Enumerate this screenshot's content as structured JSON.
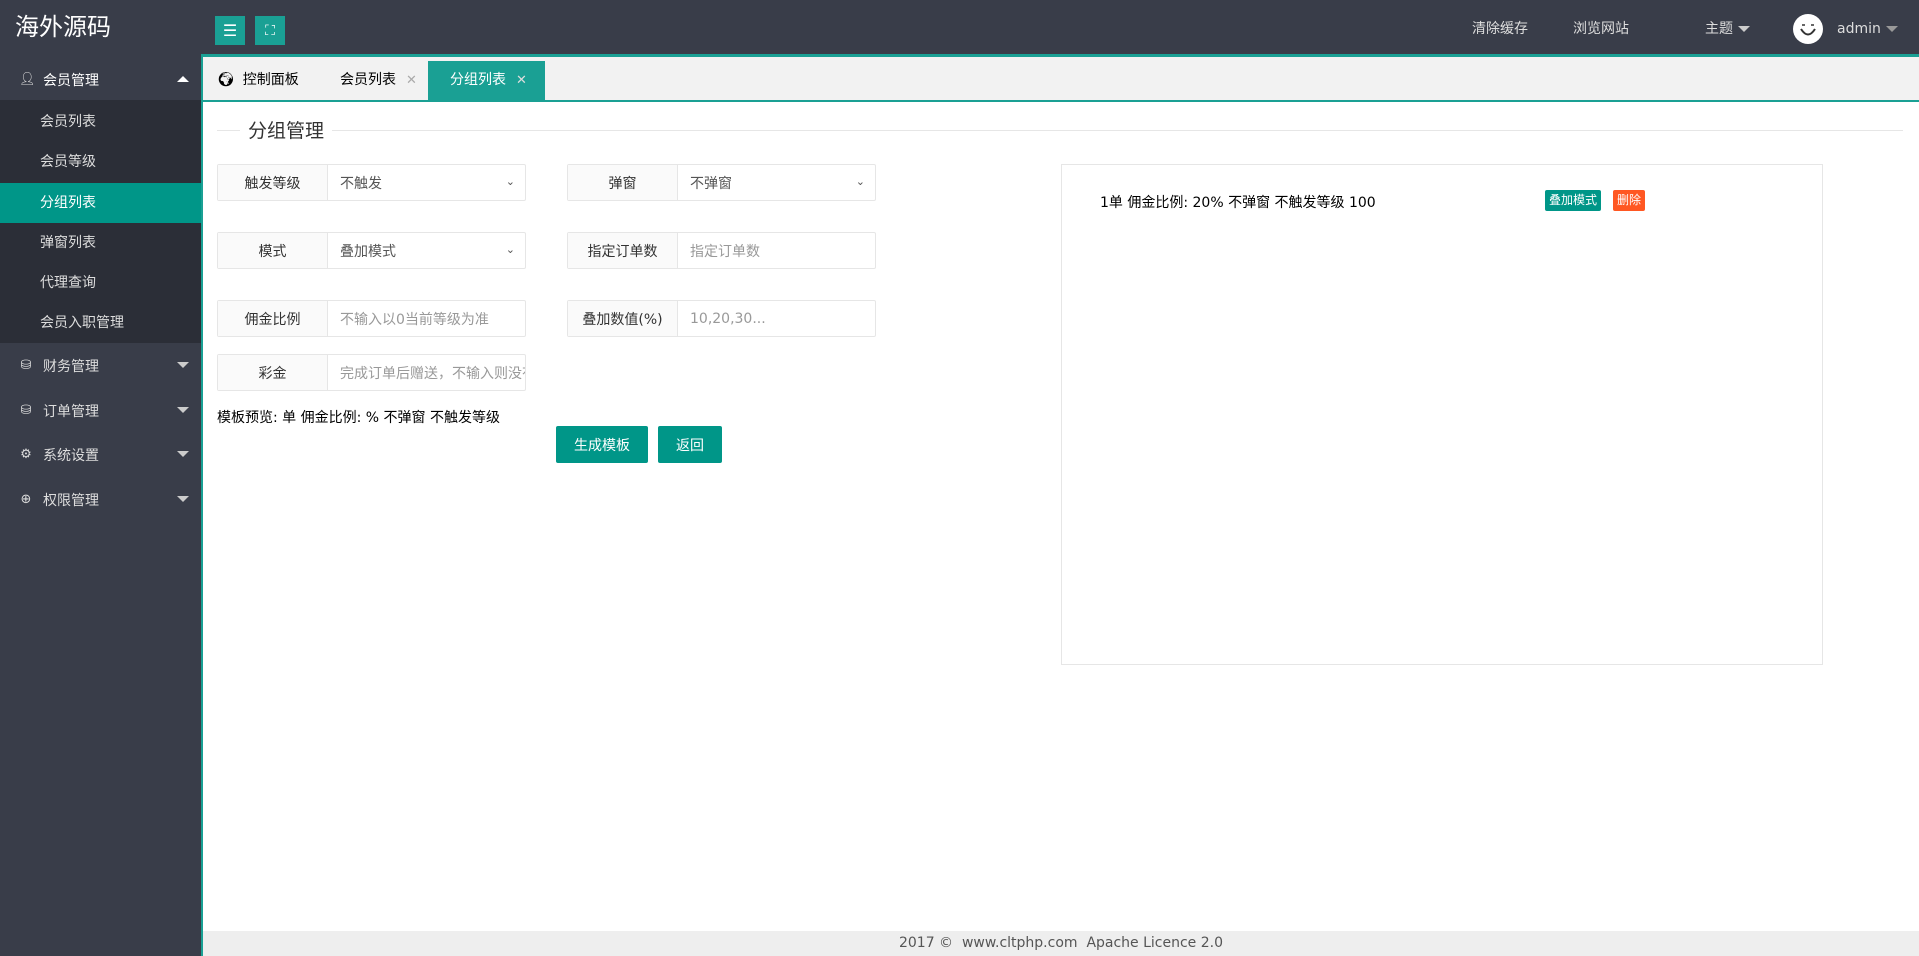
{
  "header": {
    "logo": "海外源码",
    "links": {
      "clear_cache": "清除缓存",
      "browse_site": "浏览网站",
      "theme": "主题",
      "user": "admin"
    }
  },
  "sidebar": {
    "groups": [
      {
        "label": "会员管理",
        "icon": "user-icon",
        "expanded": true
      },
      {
        "label": "财务管理",
        "icon": "database-icon"
      },
      {
        "label": "订单管理",
        "icon": "database-icon"
      },
      {
        "label": "系统设置",
        "icon": "gears-icon"
      },
      {
        "label": "权限管理",
        "icon": "globe-icon"
      }
    ],
    "sub_items": [
      {
        "label": "会员列表"
      },
      {
        "label": "会员等级"
      },
      {
        "label": "分组列表",
        "active": true
      },
      {
        "label": "弹窗列表"
      },
      {
        "label": "代理查询"
      },
      {
        "label": "会员入职管理"
      }
    ]
  },
  "tabs": [
    {
      "label": "控制面板",
      "icon": "globe-icon"
    },
    {
      "label": "会员列表",
      "closable": true
    },
    {
      "label": "分组列表",
      "closable": true,
      "active": true
    }
  ],
  "form": {
    "legend": "分组管理",
    "trigger_level": {
      "label": "触发等级",
      "value": "不触发"
    },
    "popup": {
      "label": "弹窗",
      "value": "不弹窗"
    },
    "mode": {
      "label": "模式",
      "value": "叠加模式"
    },
    "order_count": {
      "label": "指定订单数",
      "placeholder": "指定订单数"
    },
    "commission": {
      "label": "佣金比例",
      "placeholder": "不输入以0当前等级为准"
    },
    "stack_value": {
      "label": "叠加数值(%)",
      "placeholder": "10,20,30..."
    },
    "bonus": {
      "label": "彩金",
      "placeholder": "完成订单后赠送，不输入则没有"
    },
    "preview": "模板预览: 单 佣金比例: % 不弹窗 不触发等级",
    "generate_button": "生成模板",
    "back_button": "返回"
  },
  "templates": [
    {
      "text": "1单 佣金比例: 20% 不弹窗 不触发等级 100",
      "mode_badge": "叠加模式",
      "delete_label": "删除"
    }
  ],
  "footer": {
    "text": "2017 ©  www.cltphp.com  Apache Licence 2.0"
  },
  "colors": {
    "header": "#393d49",
    "accent": "#1aa094",
    "primary": "#009688",
    "danger": "#ff5722",
    "submenu": "#2b2e37"
  }
}
